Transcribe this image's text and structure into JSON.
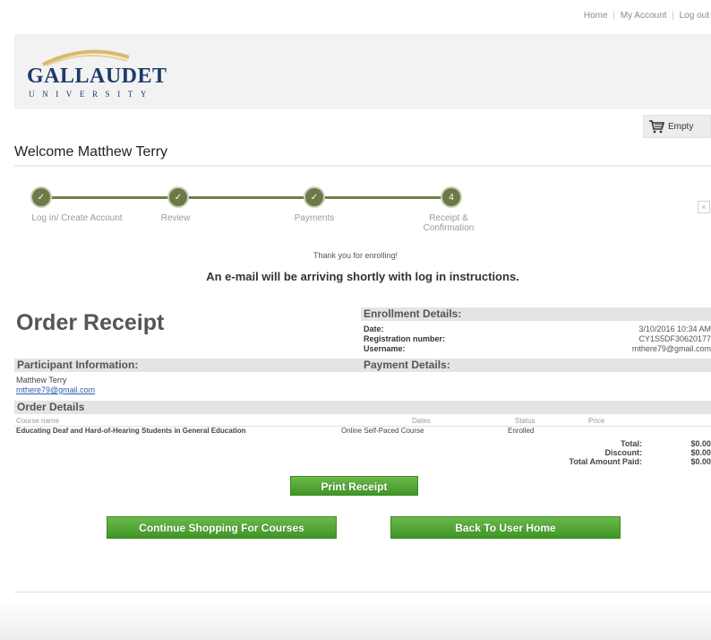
{
  "topnav": {
    "home": "Home",
    "my_account": "My Account",
    "logout": "Log out",
    "sep": "|"
  },
  "logo": {
    "word": "GALLAUDET",
    "sub": "UNIVERSITY"
  },
  "cart": {
    "label": "Empty",
    "icon": "cart-icon"
  },
  "welcome": "Welcome Matthew Terry",
  "progress": {
    "steps": [
      {
        "label": "Log in/ Create Account",
        "marker": "✓"
      },
      {
        "label": "Review",
        "marker": "✓"
      },
      {
        "label": "Payments",
        "marker": "✓"
      },
      {
        "label": "Receipt &",
        "label2": "Confirmation",
        "marker": "4"
      }
    ],
    "close": "×"
  },
  "thanks": "Thank you for enrolling!",
  "email_message": "An e-mail will be arriving shortly with log in instructions.",
  "order_title": "Order Receipt",
  "enrollment": {
    "header": "Enrollment Details:",
    "date_label": "Date:",
    "date_value": "3/10/2016 10:34 AM",
    "reg_label": "Registration number:",
    "reg_value": "CY1S5DF30620177",
    "user_label": "Username:",
    "user_value": "mthere79@gmail.com"
  },
  "participant": {
    "header": "Participant Information:",
    "name": "Matthew Terry",
    "email": "mthere79@gmail.com"
  },
  "payment": {
    "header": "Payment Details:"
  },
  "order_details": {
    "header": "Order Details",
    "columns": [
      "Course name",
      "Dates",
      "Status",
      "Price"
    ],
    "rows": [
      {
        "course": "Educating Deaf and Hard-of-Hearing Students in General Education",
        "dates": "Online Self-Paced Course",
        "status": "Enrolled",
        "price": ""
      }
    ]
  },
  "totals": {
    "total_label": "Total:",
    "total_value": "$0.00",
    "discount_label": "Discount:",
    "discount_value": "$0.00",
    "paid_label": "Total Amount Paid:",
    "paid_value": "$0.00"
  },
  "buttons": {
    "print": "Print Receipt",
    "continue": "Continue Shopping For Courses",
    "home": "Back To User Home"
  },
  "colors": {
    "brand_navy": "#1d3a6b",
    "button_green": "#4fa532",
    "step_green": "#6b7a47"
  }
}
